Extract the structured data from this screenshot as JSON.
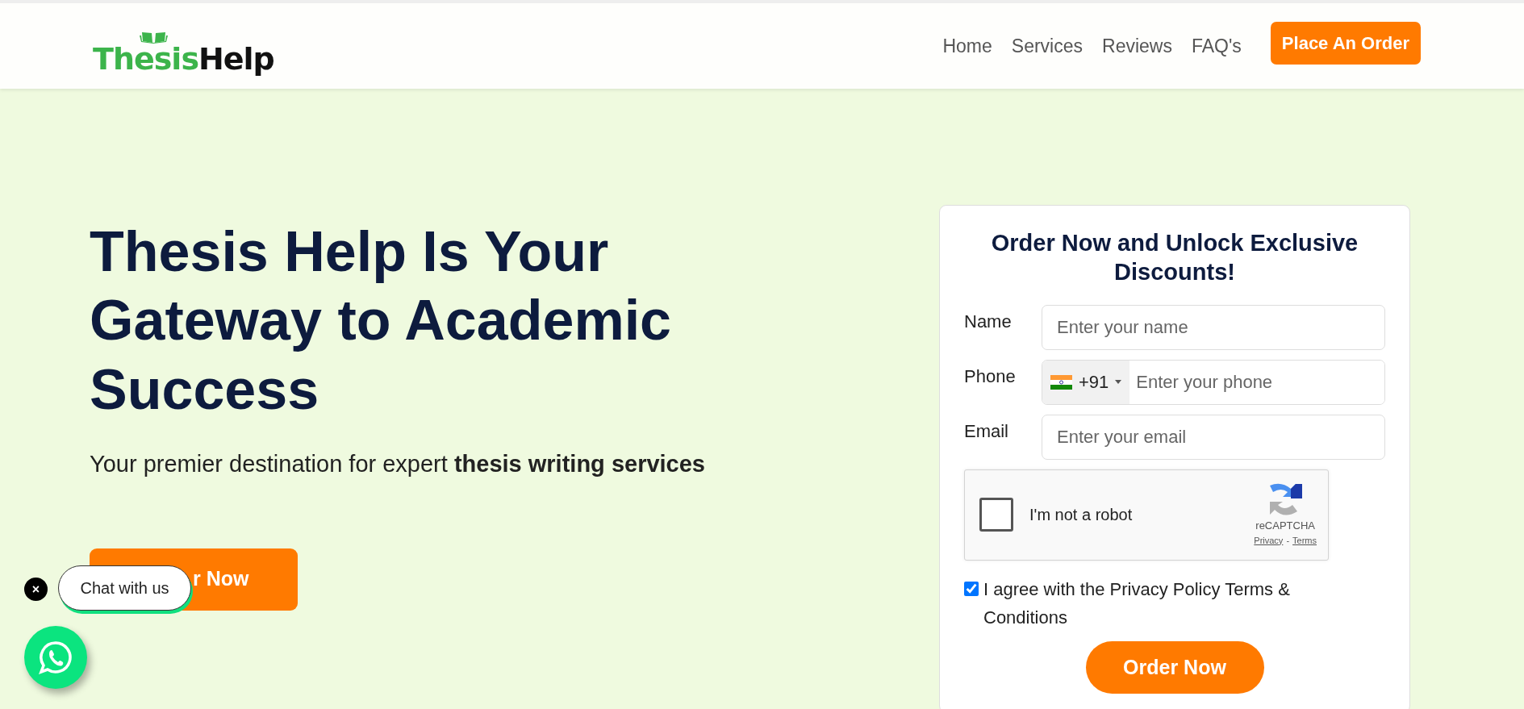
{
  "header": {
    "logo": {
      "part_1": "Thesis",
      "part_2": "Help"
    },
    "nav": [
      {
        "label": "Home"
      },
      {
        "label": "Services"
      },
      {
        "label": "Reviews"
      },
      {
        "label": "FAQ's"
      }
    ],
    "cta": "Place An Order"
  },
  "hero": {
    "title": "Thesis Help Is Your Gateway to Academic Success",
    "subtitle": "Your premier destination for expert **thesis writing services**",
    "button": "r Now"
  },
  "form": {
    "title": "Order Now and Unlock Exclusive Discounts!",
    "fields": [
      {
        "kind": "text",
        "label": "Name",
        "placeholder": "Enter your name"
      },
      {
        "kind": "phone",
        "label": "Phone",
        "dial_code": "+91",
        "placeholder": "Enter your phone"
      },
      {
        "kind": "text",
        "label": "Email",
        "placeholder": "Enter your email"
      }
    ],
    "captcha": {
      "label": "I'm not a robot",
      "checked": false,
      "brand": "reCAPTCHA",
      "privacy": "Privacy",
      "separator": "-",
      "terms": "Terms"
    },
    "agree": {
      "checked": true,
      "text": "I agree with the Privacy Policy Terms & Conditions"
    },
    "submit": "Order Now"
  },
  "chat": {
    "close": "×",
    "bubble": "Chat with us"
  }
}
